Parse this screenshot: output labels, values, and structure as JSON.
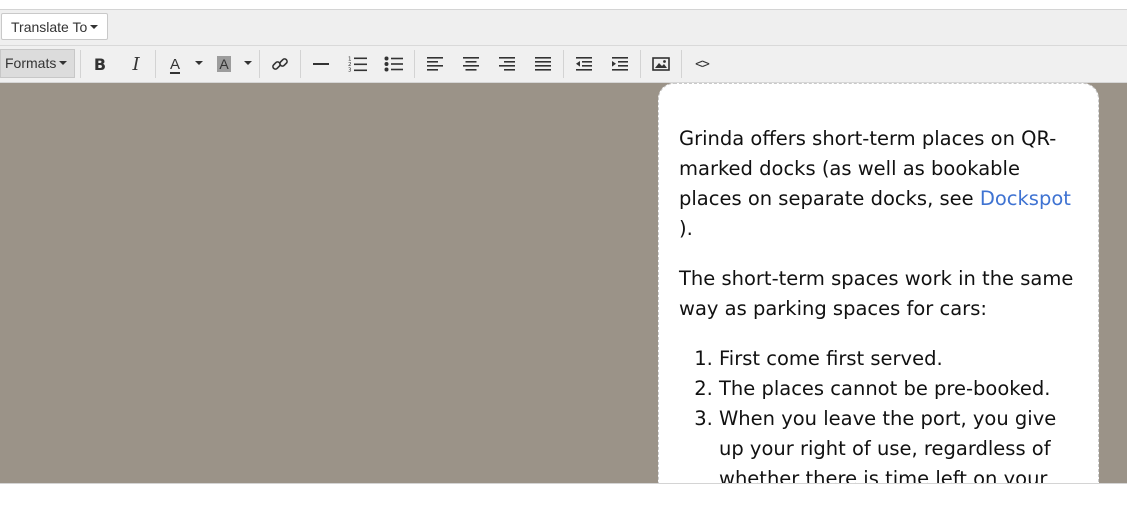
{
  "topbar": {
    "translate_label": "Translate To"
  },
  "toolbar": {
    "formats_label": "Formats",
    "buttons": [
      {
        "name": "bold",
        "icon": "bold-icon"
      },
      {
        "name": "italic",
        "icon": "italic-icon"
      },
      {
        "name": "text-color",
        "icon": "text-color-icon"
      },
      {
        "name": "background-color",
        "icon": "background-color-icon"
      },
      {
        "name": "link",
        "icon": "link-icon"
      },
      {
        "name": "horizontal-rule",
        "icon": "horizontal-rule-icon"
      },
      {
        "name": "numbered-list",
        "icon": "numbered-list-icon"
      },
      {
        "name": "bullet-list",
        "icon": "bullet-list-icon"
      },
      {
        "name": "align-left",
        "icon": "align-left-icon"
      },
      {
        "name": "align-center",
        "icon": "align-center-icon"
      },
      {
        "name": "align-right",
        "icon": "align-right-icon"
      },
      {
        "name": "justify",
        "icon": "justify-icon"
      },
      {
        "name": "outdent",
        "icon": "outdent-icon"
      },
      {
        "name": "indent",
        "icon": "indent-icon"
      },
      {
        "name": "image",
        "icon": "image-icon"
      },
      {
        "name": "source-code",
        "icon": "source-code-icon"
      }
    ],
    "color_letter": "A",
    "bold_letter": "B",
    "italic_letter": "I",
    "code_symbol": "<>"
  },
  "content": {
    "paragraph1_text": "Grinda offers short-term places on QR-marked docks (as well as bookable places on separate docks, see ",
    "paragraph1_link": "Dockspot",
    "paragraph1_end": " ).",
    "paragraph2": "The short-term spaces work in the same way as parking spaces for cars:",
    "list": [
      "First come first served.",
      "The places cannot be pre-booked.",
      "When you leave the port, you give up your right of use, regardless of whether there is time left on your"
    ]
  },
  "colors": {
    "editor_background": "#9b9388",
    "link": "#3f73d2",
    "toolbar_bg": "#f0f0f0"
  }
}
